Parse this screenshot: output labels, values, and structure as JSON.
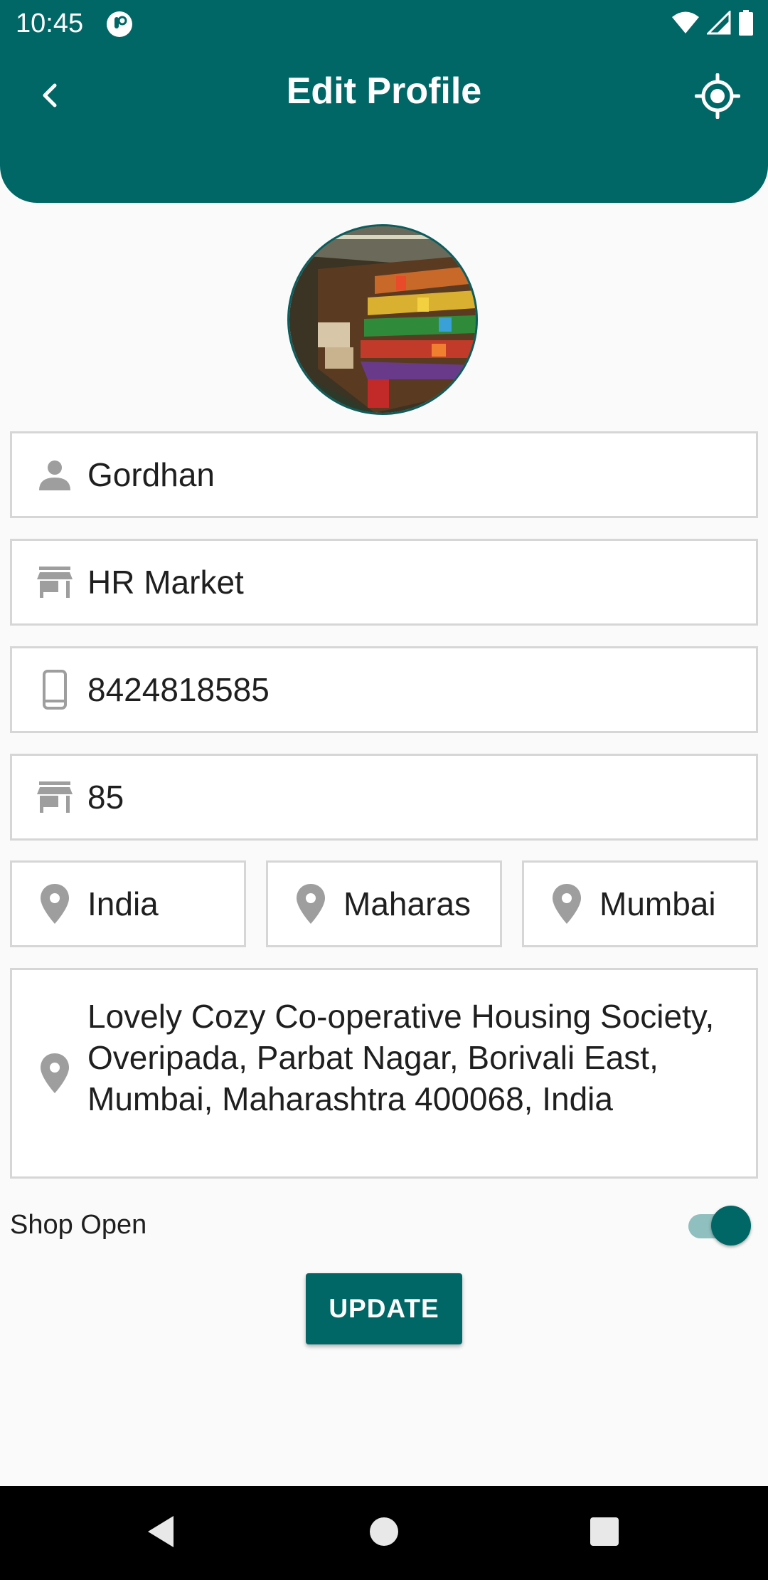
{
  "status_bar": {
    "time": "10:45"
  },
  "header": {
    "title": "Edit Profile",
    "back_icon": "chevron-left-icon",
    "locate_icon": "gps-target-icon"
  },
  "profile_image": {
    "description_icon": "store-shelves-photo"
  },
  "form": {
    "name": "Gordhan",
    "shop_name": "HR Market",
    "phone": "8424818585",
    "shop_number": "85",
    "country": "India",
    "state": "Maharas",
    "city": "Mumbai",
    "address": "Lovely Cozy Co-operative Housing Society, Overipada, Parbat Nagar, Borivali East, Mumbai, Maharashtra 400068, India"
  },
  "shop_open": {
    "label": "Shop Open",
    "enabled": true
  },
  "update_button": {
    "label": "UPDATE"
  },
  "colors": {
    "primary": "#016766",
    "field_border": "#d6d6d6",
    "icon_gray": "#9e9e9e",
    "background": "#fafafa"
  }
}
